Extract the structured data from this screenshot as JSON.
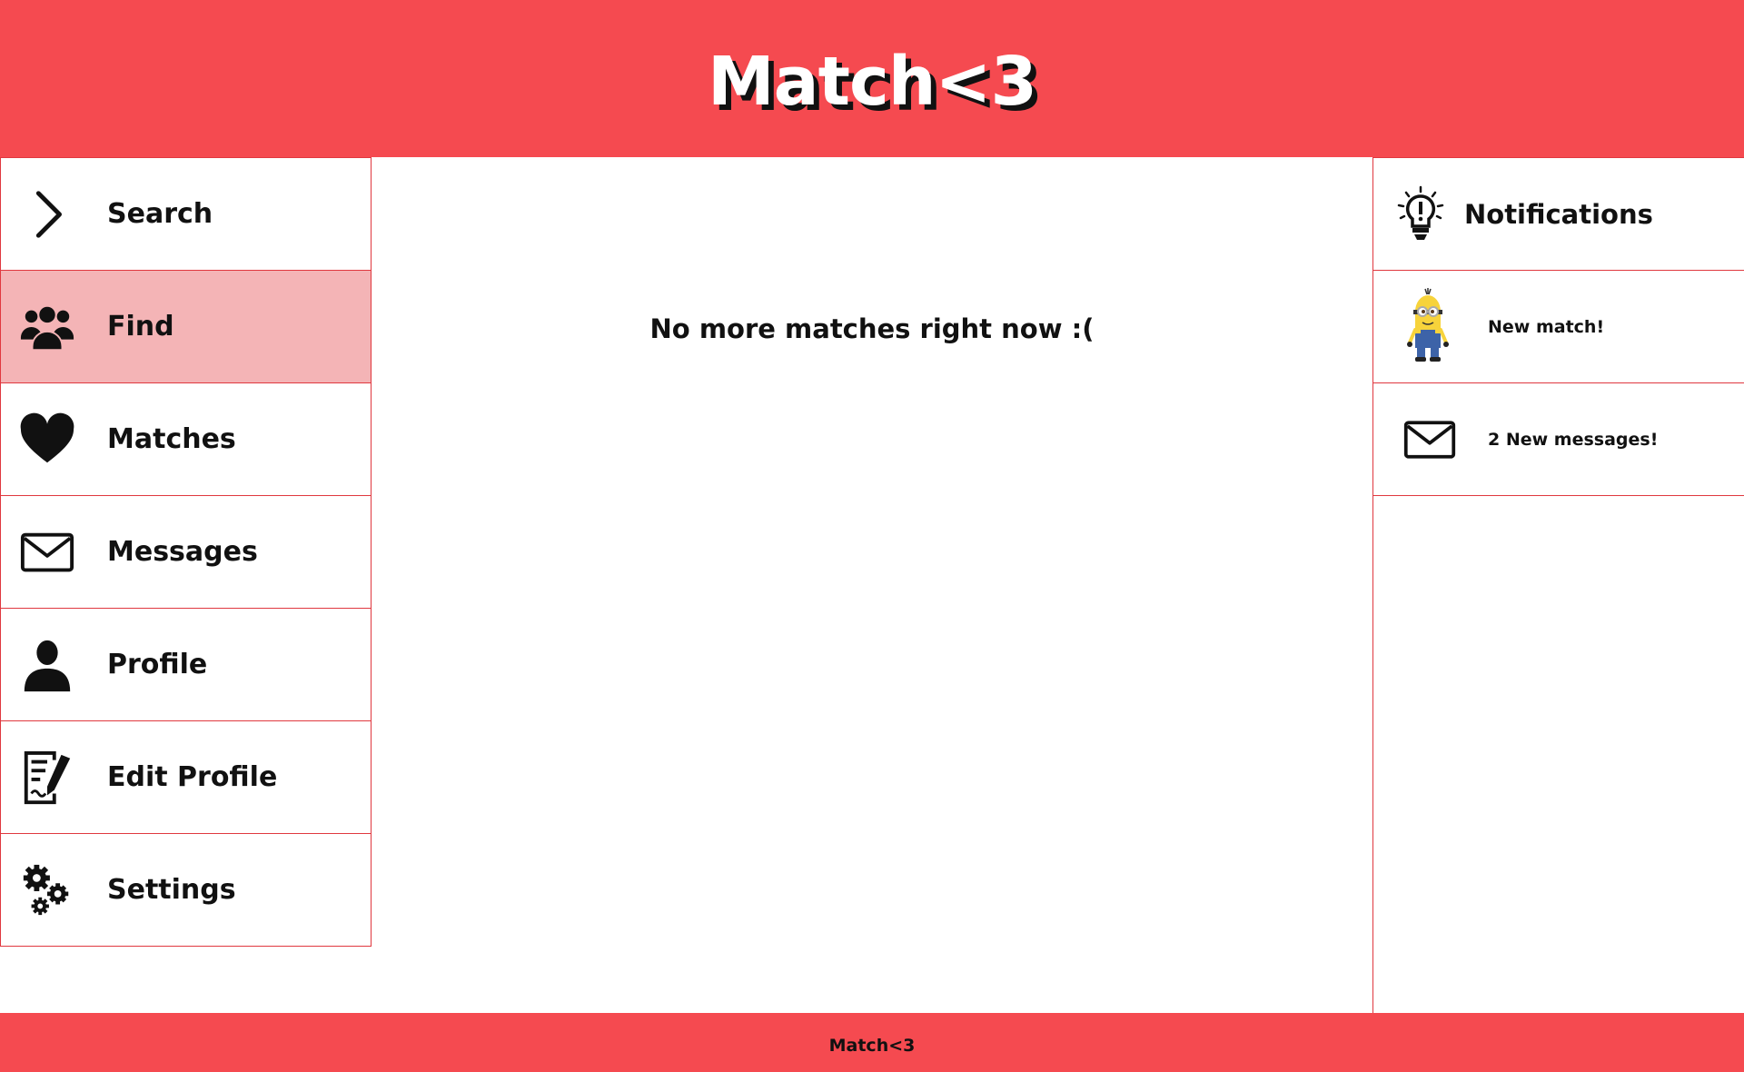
{
  "header": {
    "title": "Match<3"
  },
  "sidebar": {
    "items": [
      {
        "label": "Search",
        "icon": "chevron-right-icon",
        "active": false
      },
      {
        "label": "Find",
        "icon": "users-icon",
        "active": true
      },
      {
        "label": "Matches",
        "icon": "heart-icon",
        "active": false
      },
      {
        "label": "Messages",
        "icon": "envelope-icon",
        "active": false
      },
      {
        "label": "Profile",
        "icon": "user-icon",
        "active": false
      },
      {
        "label": "Edit Profile",
        "icon": "edit-document-icon",
        "active": false
      },
      {
        "label": "Settings",
        "icon": "gears-icon",
        "active": false
      }
    ]
  },
  "main": {
    "empty_message": "No more matches right now :("
  },
  "notifications": {
    "title": "Notifications",
    "icon": "lightbulb-icon",
    "items": [
      {
        "text": "New match!",
        "icon": "minion-avatar"
      },
      {
        "text": "2 New messages!",
        "icon": "envelope-icon"
      }
    ]
  },
  "footer": {
    "text": "Match<3"
  },
  "colors": {
    "brand": "#f54a50",
    "active_item": "#f4b4b6",
    "border": "#e0383f"
  }
}
